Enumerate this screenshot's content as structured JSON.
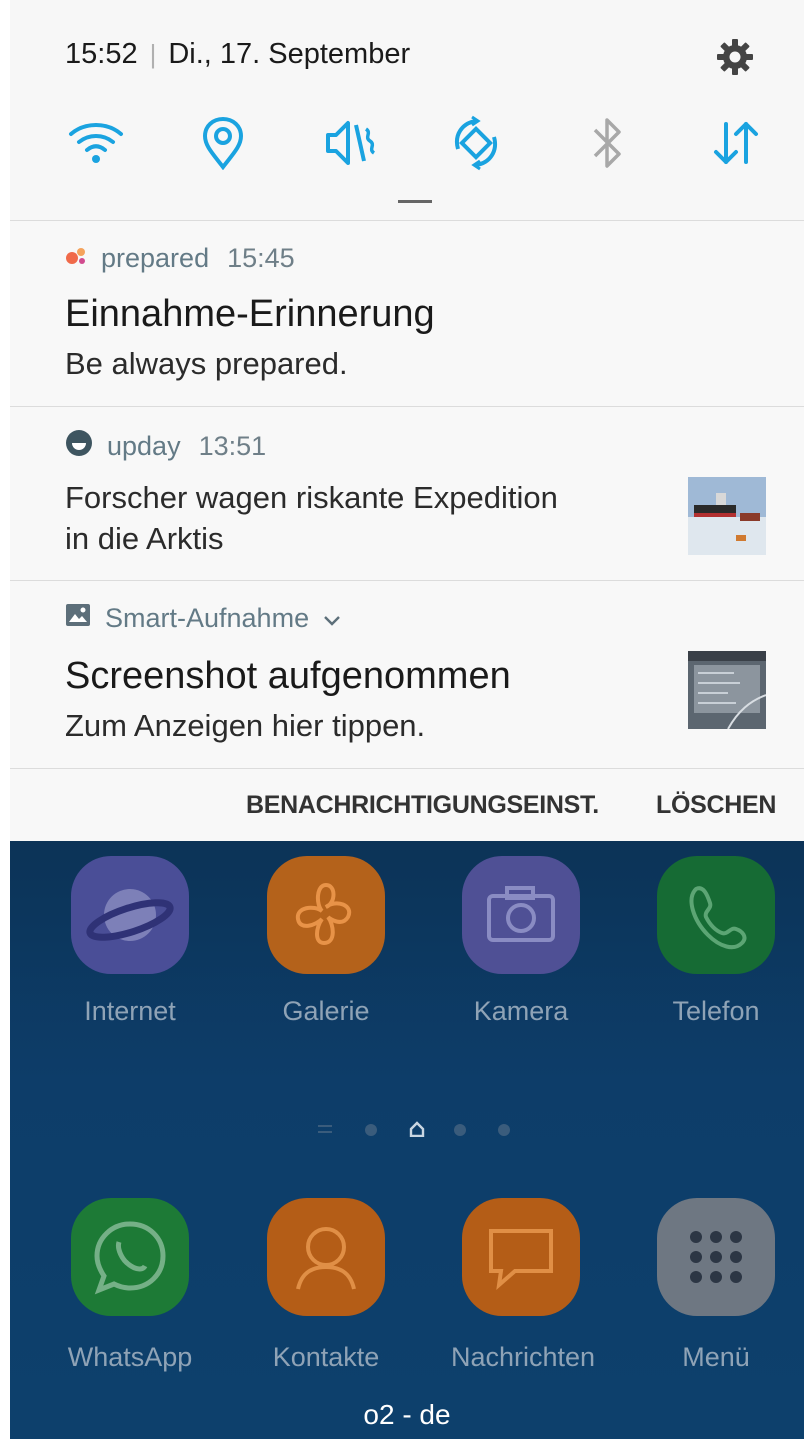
{
  "status": {
    "time": "15:52",
    "date": "Di., 17. September",
    "quick_settings": [
      "wifi-icon",
      "location-icon",
      "vibrate-icon",
      "auto-rotate-icon",
      "bluetooth-icon",
      "mobile-data-icon"
    ]
  },
  "notifications": [
    {
      "app": "prepared",
      "time": "15:45",
      "title": "Einnahme-Erinnerung",
      "text": "Be always prepared."
    },
    {
      "app": "upday",
      "time": "13:51",
      "text_line1": "Forscher wagen riskante Expedition",
      "text_line2": "in die Arktis"
    },
    {
      "app": "Smart-Aufnahme",
      "title": "Screenshot aufgenommen",
      "text": "Zum Anzeigen hier tippen."
    }
  ],
  "actions": {
    "settings": "BENACHRICHTIGUNGSEINST.",
    "clear": "LÖSCHEN"
  },
  "home": {
    "apps": [
      {
        "label": "Internet",
        "icon": "internet-icon"
      },
      {
        "label": "Galerie",
        "icon": "gallery-icon"
      },
      {
        "label": "Kamera",
        "icon": "camera-icon"
      },
      {
        "label": "Telefon",
        "icon": "phone-icon"
      }
    ],
    "dock": [
      {
        "label": "WhatsApp",
        "icon": "whatsapp-icon"
      },
      {
        "label": "Kontakte",
        "icon": "contacts-icon"
      },
      {
        "label": "Nachrichten",
        "icon": "messages-icon"
      },
      {
        "label": "Menü",
        "icon": "apps-menu-icon"
      }
    ],
    "carrier": "o2 - de"
  },
  "colors": {
    "accent": "#1aa3e0",
    "shade_bg": "#f6f6f6",
    "home_bg": "#0d3d69"
  }
}
